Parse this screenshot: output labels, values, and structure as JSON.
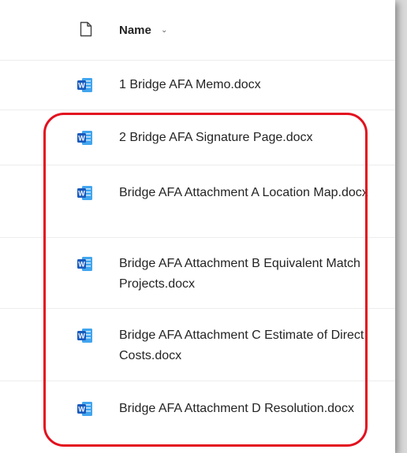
{
  "header": {
    "file_icon": "file-icon",
    "name_label": "Name",
    "sort_chevron": "⌄"
  },
  "files": [
    {
      "name": "1 Bridge AFA Memo.docx",
      "icon": "word-document-icon"
    },
    {
      "name": "2 Bridge AFA Signature Page.docx",
      "icon": "word-document-icon"
    },
    {
      "name": "Bridge AFA Attachment A Location Map.docx",
      "icon": "word-document-icon"
    },
    {
      "name": "Bridge AFA Attachment B Equivalent Match Projects.docx",
      "icon": "word-document-icon"
    },
    {
      "name": "Bridge AFA Attachment C Estimate of Direct Costs.docx",
      "icon": "word-document-icon"
    },
    {
      "name": "Bridge AFA Attachment D Resolution.docx",
      "icon": "word-document-icon"
    }
  ],
  "colors": {
    "highlight": "#e3101e",
    "word_blue": "#185abd",
    "text": "#242424"
  }
}
